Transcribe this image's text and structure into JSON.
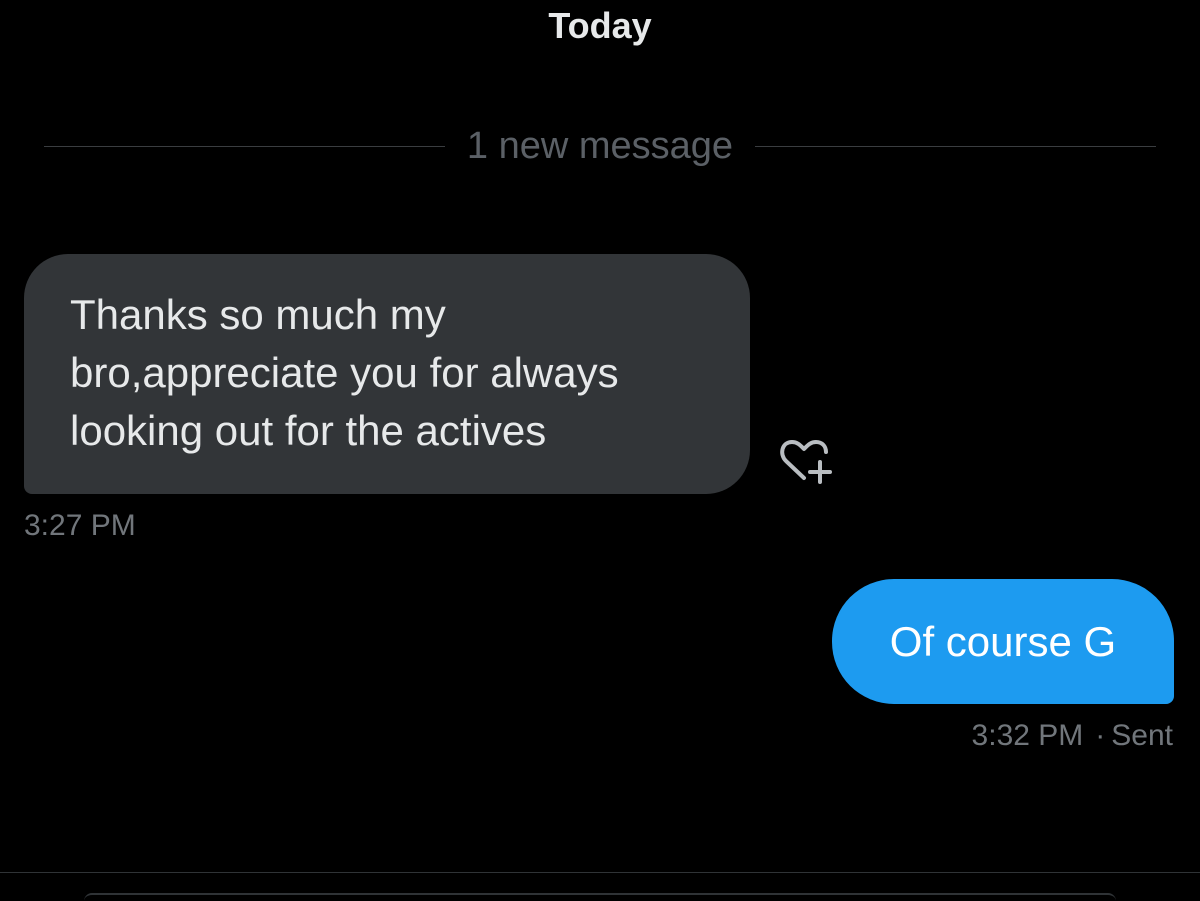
{
  "conversation": {
    "date_label": "Today",
    "new_message_divider": "1 new message"
  },
  "messages": [
    {
      "direction": "incoming",
      "lines": [
        "Thanks so much my",
        "bro,appreciate you for always",
        "looking out for the actives"
      ],
      "time": "3:27 PM",
      "reaction_icon": "heart-plus-icon"
    },
    {
      "direction": "outgoing",
      "text": "Of course G",
      "time": "3:32 PM",
      "status": "Sent"
    }
  ],
  "colors": {
    "background": "#000000",
    "incoming_bubble": "#323538",
    "outgoing_bubble": "#1d9bf0",
    "muted_text": "#71767b"
  }
}
